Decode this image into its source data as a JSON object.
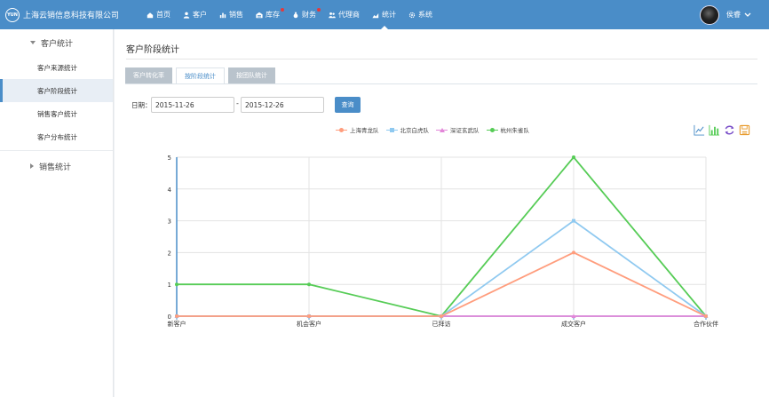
{
  "brand": {
    "logo_text": "YUN",
    "name": "上海云销信息科技有限公司"
  },
  "nav": [
    {
      "label": "首页",
      "icon": "home-icon",
      "dot": false,
      "active": false
    },
    {
      "label": "客户",
      "icon": "user-icon",
      "dot": false,
      "active": false
    },
    {
      "label": "销售",
      "icon": "chart-bars-icon",
      "dot": false,
      "active": false
    },
    {
      "label": "库存",
      "icon": "warehouse-icon",
      "dot": true,
      "active": false
    },
    {
      "label": "财务",
      "icon": "money-bag-icon",
      "dot": true,
      "active": false
    },
    {
      "label": "代理商",
      "icon": "agents-icon",
      "dot": false,
      "active": false
    },
    {
      "label": "统计",
      "icon": "statistics-icon",
      "dot": false,
      "active": true
    },
    {
      "label": "系统",
      "icon": "gear-icon",
      "dot": false,
      "active": false
    }
  ],
  "user": {
    "name": "侯睿"
  },
  "sidebar": {
    "group1": {
      "title": "客户统计",
      "items": [
        {
          "label": "客户来源统计",
          "active": false
        },
        {
          "label": "客户阶段统计",
          "active": true
        },
        {
          "label": "销售客户统计",
          "active": false
        },
        {
          "label": "客户分布统计",
          "active": false
        }
      ]
    },
    "group2": {
      "title": "销售统计"
    }
  },
  "main": {
    "title": "客户阶段统计",
    "tabs": [
      "客户转化率",
      "按阶段统计",
      "按团队统计"
    ],
    "active_tab": 1,
    "date_label": "日期：",
    "date_from": "2015-11-26",
    "date_sep": "-",
    "date_to": "2015-12-26",
    "query_label": "查询"
  },
  "chart_data": {
    "type": "line",
    "categories": [
      "新客户",
      "机会客户",
      "已拜访",
      "成交客户",
      "合作伙伴"
    ],
    "ylim": [
      0,
      5
    ],
    "yticks": [
      "0",
      "1",
      "2",
      "3",
      "4",
      "5"
    ],
    "legend_position": "top-center",
    "grid": true,
    "series": [
      {
        "name": "上海青龙队",
        "color": "#ff9d7d",
        "marker": "circle",
        "values": [
          0,
          0,
          0,
          2,
          0
        ]
      },
      {
        "name": "北京白虎队",
        "color": "#8fc9f0",
        "marker": "square",
        "values": [
          0,
          0,
          0,
          3,
          0
        ]
      },
      {
        "name": "深证玄武队",
        "color": "#e387d9",
        "marker": "triangle",
        "values": [
          0,
          0,
          0,
          0,
          0
        ]
      },
      {
        "name": "杭州朱雀队",
        "color": "#56cc56",
        "marker": "circle",
        "values": [
          1,
          1,
          0,
          5,
          0
        ]
      }
    ]
  },
  "toolbox": [
    {
      "icon": "line-chart-icon",
      "color": "#4a8dc8"
    },
    {
      "icon": "bar-chart-icon",
      "color": "#56cc56"
    },
    {
      "icon": "refresh-icon",
      "color": "#7a4fc9"
    },
    {
      "icon": "save-image-icon",
      "color": "#e89b2c"
    }
  ]
}
